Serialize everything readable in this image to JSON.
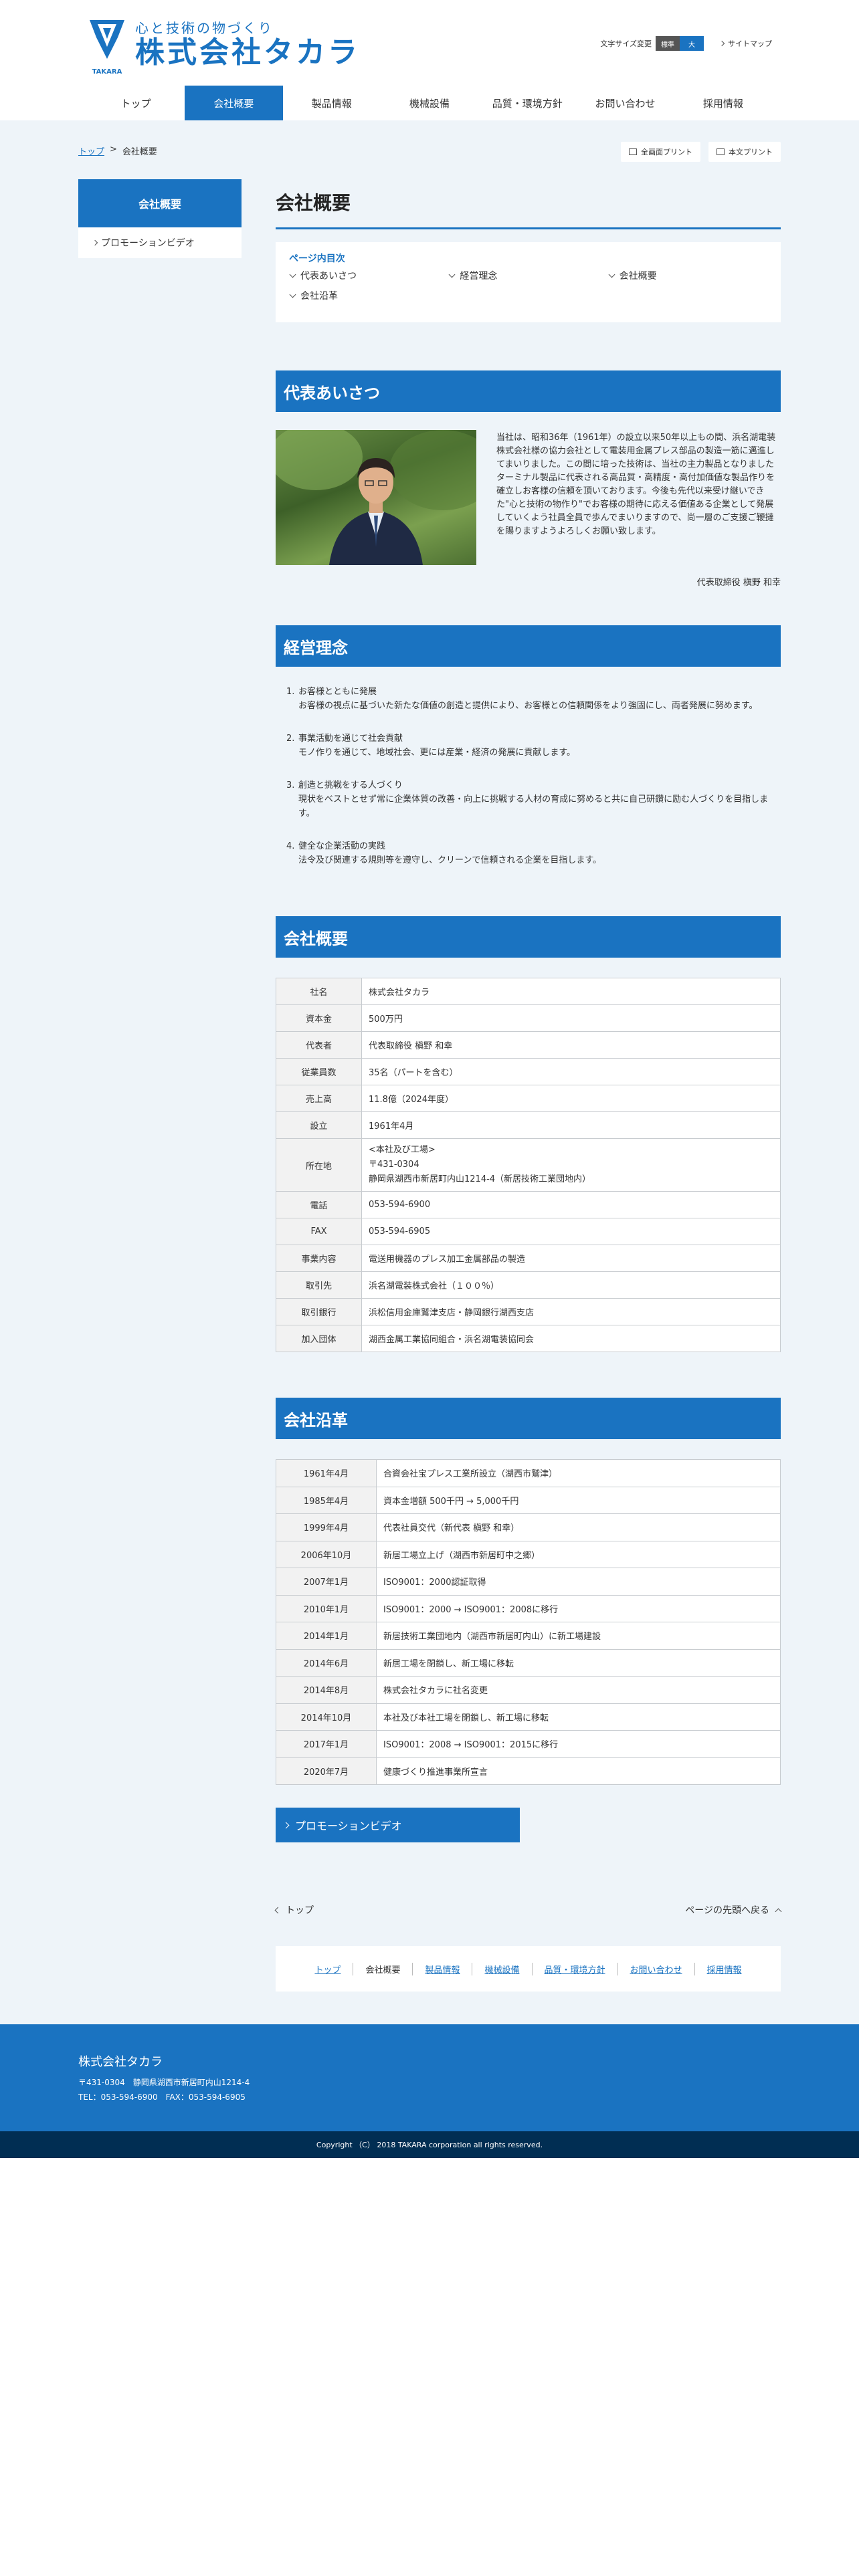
{
  "header": {
    "logo_tagline": "心と技術の物づくり",
    "logo_name": "株式会社タカラ",
    "logo_mark_text": "TAKARA",
    "font_size_label": "文字サイズ変更",
    "font_size_standard": "標準",
    "font_size_large": "大",
    "sitemap": "サイトマップ"
  },
  "nav": [
    "トップ",
    "会社概要",
    "製品情報",
    "機械設備",
    "品質・環境方針",
    "お問い合わせ",
    "採用情報"
  ],
  "breadcrumb": {
    "home": "トップ",
    "sep": ">",
    "current": "会社概要"
  },
  "print": {
    "full": "全画面プリント",
    "body": "本文プリント"
  },
  "sidebar": {
    "heading": "会社概要",
    "items": [
      "プロモーションビデオ"
    ]
  },
  "page_title": "会社概要",
  "toc": {
    "title": "ページ内目次",
    "links": [
      "代表あいさつ",
      "経営理念",
      "会社概要",
      "会社沿革"
    ]
  },
  "greeting": {
    "heading": "代表あいさつ",
    "text": "当社は、昭和36年（1961年）の設立以来50年以上もの間、浜名湖電装株式会社様の協力会社として電装用金属プレス部品の製造一筋に邁進してまいりました。この間に培った技術は、当社の主力製品となりましたターミナル製品に代表される高品質・高精度・高付加価値な製品作りを確立しお客様の信頼を頂いております。今後も先代以来受け継いできた\"心と技術の物作り\"でお客様の期待に応える価値ある企業として発展していくよう社員全員で歩んでまいりますので、尚一層のご支援ご鞭撻を賜りますようよろしくお願い致します。",
    "signature": "代表取締役 槇野 和幸"
  },
  "philosophy": {
    "heading": "経営理念",
    "items": [
      {
        "num": "1.",
        "title": "お客様とともに発展",
        "body": "お客様の視点に基づいた新たな価値の創造と提供により、お客様との信頼関係をより強固にし、両者発展に努めます。"
      },
      {
        "num": "2.",
        "title": "事業活動を通じて社会貢献",
        "body": "モノ作りを通じて、地域社会、更には産業・経済の発展に貢献します。"
      },
      {
        "num": "3.",
        "title": "創造と挑戦をする人づくり",
        "body": "現状をベストとせず常に企業体質の改善・向上に挑戦する人材の育成に努めると共に自己研鑽に励む人づくりを目指します。"
      },
      {
        "num": "4.",
        "title": "健全な企業活動の実践",
        "body": "法令及び関連する規則等を遵守し、クリーンで信頼される企業を目指します。"
      }
    ]
  },
  "profile": {
    "heading": "会社概要",
    "rows": [
      {
        "label": "社名",
        "value": "株式会社タカラ"
      },
      {
        "label": "資本金",
        "value": "500万円"
      },
      {
        "label": "代表者",
        "value": "代表取締役 槇野 和幸"
      },
      {
        "label": "従業員数",
        "value": "35名（パートを含む）"
      },
      {
        "label": "売上高",
        "value": "11.8億（2024年度）"
      },
      {
        "label": "設立",
        "value": "1961年4月"
      },
      {
        "label": "所在地",
        "value": "<本社及び工場>",
        "value2": "〒431-0304",
        "value3": "静岡県湖西市新居町内山1214-4（新居技術工業団地内）"
      },
      {
        "label": "電話",
        "value": "053-594-6900"
      },
      {
        "label": "FAX",
        "value": "053-594-6905"
      },
      {
        "label": "事業内容",
        "value": "電送用機器のプレス加工金属部品の製造"
      },
      {
        "label": "取引先",
        "value": "浜名湖電装株式会社（１００％）"
      },
      {
        "label": "取引銀行",
        "value": "浜松信用金庫鷲津支店・静岡銀行湖西支店"
      },
      {
        "label": "加入団体",
        "value": "湖西金属工業協同組合・浜名湖電装協同会"
      }
    ]
  },
  "history": {
    "heading": "会社沿革",
    "rows": [
      {
        "date": "1961年4月",
        "event": "合資会社宝プレス工業所設立（湖西市鷲津）"
      },
      {
        "date": "1985年4月",
        "event": "資本金増額 500千円 → 5,000千円"
      },
      {
        "date": "1999年4月",
        "event": "代表社員交代（新代表 槇野 和幸）"
      },
      {
        "date": "2006年10月",
        "event": "新居工場立上げ（湖西市新居町中之郷）"
      },
      {
        "date": "2007年1月",
        "event": "ISO9001：2000認証取得"
      },
      {
        "date": "2010年1月",
        "event": "ISO9001：2000 → ISO9001：2008に移行"
      },
      {
        "date": "2014年1月",
        "event": "新居技術工業団地内（湖西市新居町内山）に新工場建設"
      },
      {
        "date": "2014年6月",
        "event": "新居工場を閉鎖し、新工場に移転"
      },
      {
        "date": "2014年8月",
        "event": "株式会社タカラに社名変更"
      },
      {
        "date": "2014年10月",
        "event": "本社及び本社工場を閉鎖し、新工場に移転"
      },
      {
        "date": "2017年1月",
        "event": "ISO9001：2008 → ISO9001：2015に移行"
      },
      {
        "date": "2020年7月",
        "event": "健康づくり推進事業所宣言"
      }
    ]
  },
  "promo_button": "プロモーションビデオ",
  "bottom": {
    "back": "トップ",
    "top": "ページの先頭へ戻る"
  },
  "footer_links": [
    "トップ",
    "会社概要",
    "製品情報",
    "機械設備",
    "品質・環境方針",
    "お問い合わせ",
    "採用情報"
  ],
  "footer": {
    "company": "株式会社タカラ",
    "address": "〒431-0304　静岡県湖西市新居町内山1214-4",
    "tel": "TEL：053-594-6900　FAX：053-594-6905",
    "copyright": "Copyright （C） 2018 TAKARA corporation all rights reserved."
  },
  "colors": {
    "brand": "#1a73c1",
    "background": "#eef4f9",
    "footer_dark": "#012e53"
  }
}
